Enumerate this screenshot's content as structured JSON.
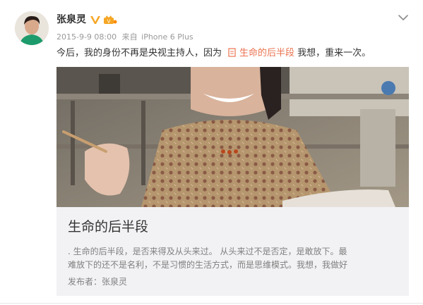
{
  "author": {
    "name": "张泉灵",
    "verified_color": "#f5a623"
  },
  "meta": {
    "timestamp": "2015-9-9 08:00",
    "from_label": "来自",
    "device": "iPhone 6 Plus"
  },
  "post": {
    "text_before": "今后，我的身份不再是央视主持人，因为",
    "link_text": "生命的后半段",
    "text_after": " 我想，重来一次。"
  },
  "card": {
    "title": "生命的后半段",
    "desc_line1": ". 生命的后半段，是否来得及从头来过。 从头来过不是否定，是敢放下。最",
    "desc_line2": "难放下的还不是名利，不是习惯的生活方式，而是思维模式。我想，我做好",
    "publisher": "发布者：张泉灵"
  },
  "icons": {
    "verified": "verified-v-icon",
    "member": "member-crown-icon",
    "expand": "chevron-down-icon",
    "article": "document-icon"
  },
  "colors": {
    "link": "#eb7350",
    "meta": "#999999",
    "card_bg": "#f2f2f5"
  }
}
